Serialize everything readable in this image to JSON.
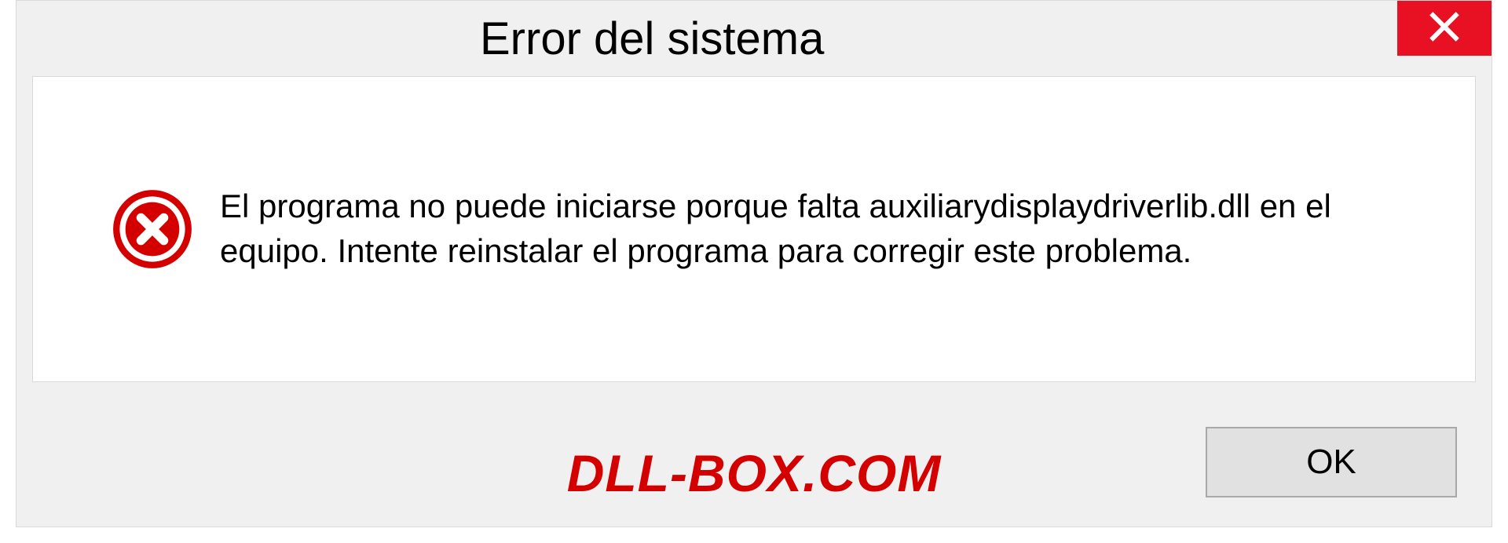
{
  "dialog": {
    "title": "Error del sistema",
    "message": "El programa no puede iniciarse porque falta auxiliarydisplaydriverlib.dll en el equipo. Intente reinstalar el programa para corregir este problema.",
    "ok_label": "OK"
  },
  "watermark": "DLL-BOX.COM"
}
